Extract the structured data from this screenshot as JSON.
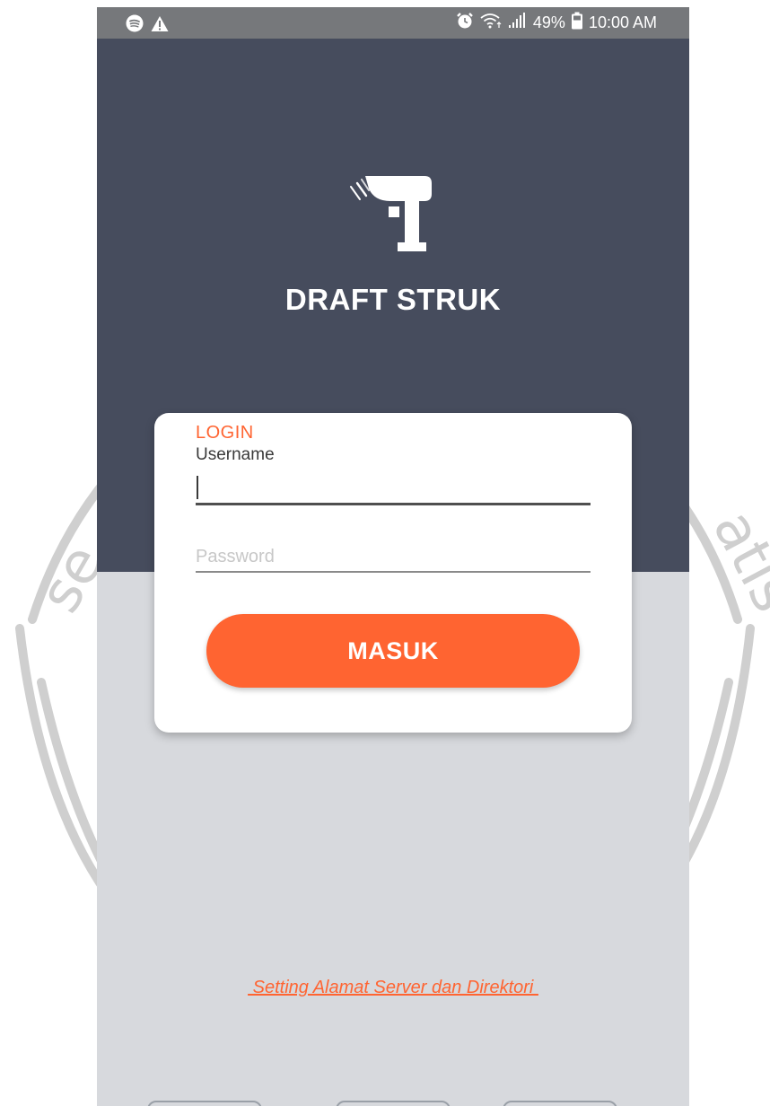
{
  "status_bar": {
    "time": "10:00 AM",
    "battery_percent": "49%",
    "left_icons": [
      "spotify-icon",
      "warning-icon"
    ],
    "right_icons": [
      "alarm-icon",
      "wifi-icon",
      "signal-icon",
      "battery-icon"
    ]
  },
  "app": {
    "title": "DRAFT STRUK",
    "logo_icon": "barcode-scanner-icon"
  },
  "login": {
    "heading": "LOGIN",
    "username_label": "Username",
    "username_value": "",
    "password_placeholder": "Password",
    "submit_label": "MASUK"
  },
  "settings_link": " Setting Alamat Server dan Direktori ",
  "watermark": {
    "left_text": "se",
    "right_text": "atis"
  },
  "colors": {
    "accent": "#ff6431",
    "header_bg": "#464c5d",
    "body_bg": "#d7d9dd",
    "status_bar_bg": "#76787b",
    "card_bg": "#ffffff"
  }
}
